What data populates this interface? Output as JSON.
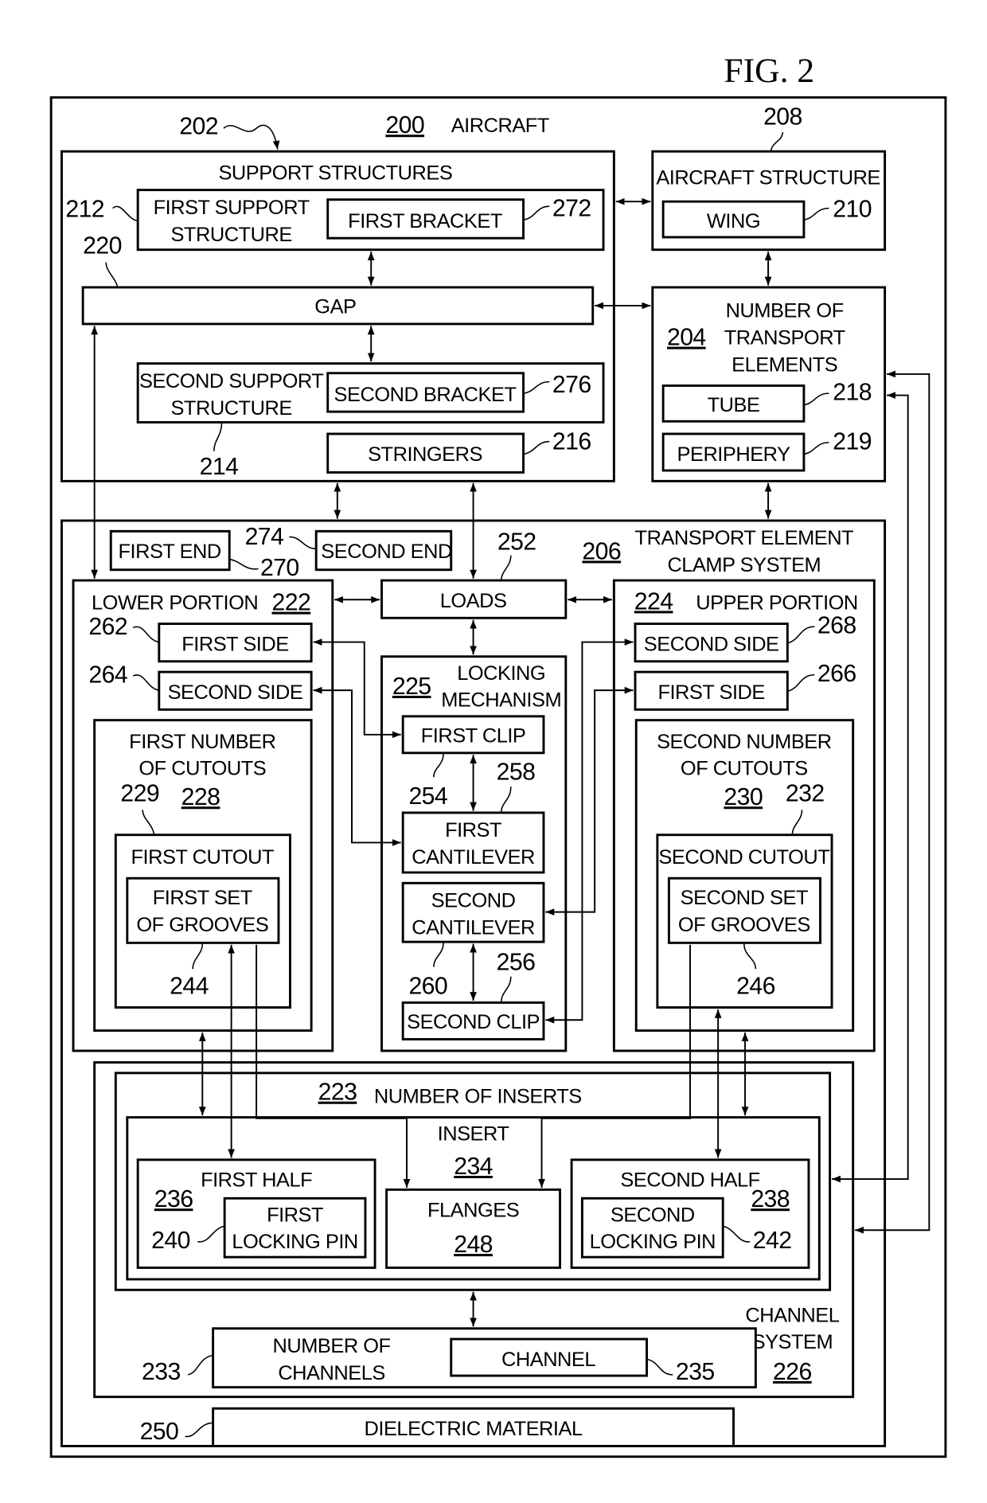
{
  "figure_title": "FIG. 2",
  "aircraft": {
    "ref": "200",
    "label": "AIRCRAFT"
  },
  "support_structures": {
    "ref": "202",
    "label": "SUPPORT STRUCTURES",
    "first_support_structure": {
      "ref": "212",
      "line1": "FIRST SUPPORT",
      "line2": "STRUCTURE"
    },
    "first_bracket": {
      "ref": "272",
      "label": "FIRST BRACKET"
    },
    "gap": {
      "ref": "220",
      "label": "GAP"
    },
    "second_support_structure": {
      "ref": "214",
      "line1": "SECOND SUPPORT",
      "line2": "STRUCTURE"
    },
    "second_bracket": {
      "ref": "276",
      "label": "SECOND BRACKET"
    },
    "stringers": {
      "ref": "216",
      "label": "STRINGERS"
    }
  },
  "aircraft_structure": {
    "ref": "208",
    "label": "AIRCRAFT STRUCTURE",
    "wing": {
      "ref": "210",
      "label": "WING"
    }
  },
  "transport_elements": {
    "ref": "204",
    "line1": "NUMBER OF",
    "line2": "TRANSPORT",
    "line3": "ELEMENTS",
    "tube": {
      "ref": "218",
      "label": "TUBE"
    },
    "periphery": {
      "ref": "219",
      "label": "PERIPHERY"
    }
  },
  "clamp_system": {
    "ref": "206",
    "line1": "TRANSPORT ELEMENT",
    "line2": "CLAMP SYSTEM",
    "first_end": {
      "ref": "270",
      "label": "FIRST END"
    },
    "second_end": {
      "ref": "274",
      "label": "SECOND END"
    },
    "loads": {
      "ref": "252",
      "label": "LOADS"
    },
    "lower_portion": {
      "ref": "222",
      "label": "LOWER PORTION",
      "first_side": {
        "ref": "262",
        "label": "FIRST SIDE"
      },
      "second_side": {
        "ref": "264",
        "label": "SECOND SIDE"
      },
      "cutouts": {
        "ref": "228",
        "line1": "FIRST NUMBER",
        "line2": "OF CUTOUTS"
      },
      "cutout": {
        "ref": "229",
        "label": "FIRST CUTOUT"
      },
      "grooves": {
        "ref": "244",
        "line1": "FIRST SET",
        "line2": "OF GROOVES"
      }
    },
    "locking_mechanism": {
      "ref": "225",
      "line1": "LOCKING",
      "line2": "MECHANISM",
      "first_clip": {
        "ref": "254",
        "label": "FIRST CLIP"
      },
      "first_cantilever": {
        "ref": "258",
        "line1": "FIRST",
        "line2": "CANTILEVER"
      },
      "second_cantilever": {
        "ref": "260",
        "line1": "SECOND",
        "line2": "CANTILEVER"
      },
      "second_clip": {
        "ref": "256",
        "label": "SECOND CLIP"
      }
    },
    "upper_portion": {
      "ref": "224",
      "label": "UPPER PORTION",
      "second_side": {
        "ref": "268",
        "label": "SECOND SIDE"
      },
      "first_side": {
        "ref": "266",
        "label": "FIRST SIDE"
      },
      "cutouts": {
        "ref": "230",
        "line1": "SECOND NUMBER",
        "line2": "OF CUTOUTS"
      },
      "cutout": {
        "ref": "232",
        "label": "SECOND CUTOUT"
      },
      "grooves": {
        "ref": "246",
        "line1": "SECOND SET",
        "line2": "OF GROOVES"
      }
    }
  },
  "channel_system": {
    "ref": "226",
    "line1": "CHANNEL",
    "line2": "SYSTEM",
    "inserts": {
      "ref": "223",
      "label": "NUMBER OF INSERTS"
    },
    "insert": {
      "ref": "234",
      "label": "INSERT"
    },
    "first_half": {
      "ref": "236",
      "label": "FIRST HALF"
    },
    "first_locking_pin": {
      "ref": "240",
      "line1": "FIRST",
      "line2": "LOCKING PIN"
    },
    "flanges": {
      "ref": "248",
      "label": "FLANGES"
    },
    "second_half": {
      "ref": "238",
      "label": "SECOND HALF"
    },
    "second_locking_pin": {
      "ref": "242",
      "line1": "SECOND",
      "line2": "LOCKING PIN"
    },
    "channels": {
      "ref": "233",
      "line1": "NUMBER OF",
      "line2": "CHANNELS"
    },
    "channel": {
      "ref": "235",
      "label": "CHANNEL"
    }
  },
  "dielectric_material": {
    "ref": "250",
    "label": "DIELECTRIC MATERIAL"
  }
}
